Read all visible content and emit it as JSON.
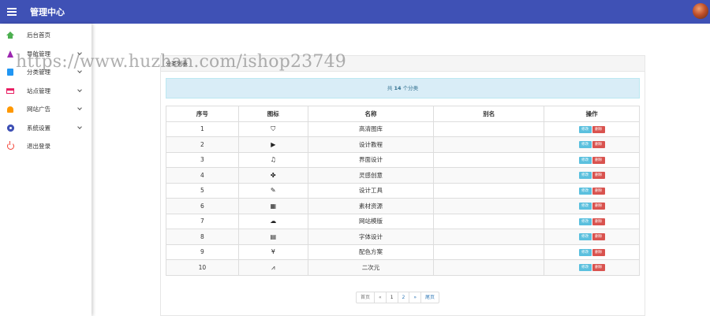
{
  "header": {
    "title": "管理中心"
  },
  "sidebar": {
    "items": [
      {
        "label": "后台首页",
        "icon": "home-icon",
        "has_children": false
      },
      {
        "label": "导航管理",
        "icon": "navigation-icon",
        "has_children": true
      },
      {
        "label": "分类管理",
        "icon": "category-icon",
        "has_children": true
      },
      {
        "label": "站点管理",
        "icon": "site-icon",
        "has_children": true
      },
      {
        "label": "网站广告",
        "icon": "bell-icon",
        "has_children": true
      },
      {
        "label": "系统设置",
        "icon": "gear-icon",
        "has_children": true
      },
      {
        "label": "退出登录",
        "icon": "power-icon",
        "has_children": false
      }
    ]
  },
  "watermark": "https://www.huzhan.com/ishop23749",
  "panel": {
    "title": "分类列表"
  },
  "info": {
    "prefix": "共",
    "count": "14",
    "suffix": "个分类"
  },
  "table": {
    "headers": {
      "seq": "序号",
      "icon": "图标",
      "name": "名称",
      "alias": "别名",
      "actions": "操作"
    },
    "edit_label": "修改",
    "delete_label": "删除",
    "rows": [
      {
        "seq": "1",
        "icon": "⛉",
        "icon_name": "shield-icon",
        "name": "高清图库",
        "alias": ""
      },
      {
        "seq": "2",
        "icon": "▶",
        "icon_name": "video-icon",
        "name": "设计教程",
        "alias": ""
      },
      {
        "seq": "3",
        "icon": "♫",
        "icon_name": "music-icon",
        "name": "界面设计",
        "alias": ""
      },
      {
        "seq": "4",
        "icon": "✤",
        "icon_name": "palette-icon",
        "name": "灵感创意",
        "alias": ""
      },
      {
        "seq": "5",
        "icon": "✎",
        "icon_name": "graduation-cap-icon",
        "name": "设计工具",
        "alias": ""
      },
      {
        "seq": "6",
        "icon": "▦",
        "icon_name": "grid-icon",
        "name": "素材资源",
        "alias": ""
      },
      {
        "seq": "7",
        "icon": "☁",
        "icon_name": "cloud-icon",
        "name": "网站模版",
        "alias": ""
      },
      {
        "seq": "8",
        "icon": "▤",
        "icon_name": "file-icon",
        "name": "字体设计",
        "alias": ""
      },
      {
        "seq": "9",
        "icon": "¥",
        "icon_name": "yen-icon",
        "name": "配色方案",
        "alias": ""
      },
      {
        "seq": "10",
        "icon": "⩘",
        "icon_name": "chart-line-icon",
        "name": "二次元",
        "alias": ""
      }
    ]
  },
  "pagination": {
    "first": "首页",
    "prev": "«",
    "pages": [
      "1",
      "2"
    ],
    "next": "»",
    "last": "尾页"
  }
}
